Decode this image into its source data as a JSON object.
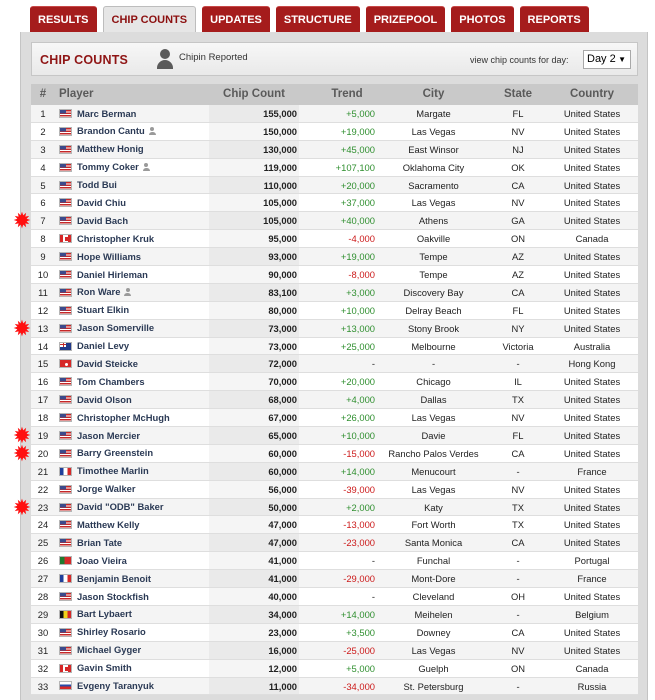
{
  "tabs": [
    "RESULTS",
    "CHIP COUNTS",
    "UPDATES",
    "STRUCTURE",
    "PRIZEPOOL",
    "PHOTOS",
    "REPORTS"
  ],
  "active_tab": "CHIP COUNTS",
  "header": {
    "title": "CHIP COUNTS",
    "chipin_label": "Chipin Reported",
    "day_label": "view chip counts for day:",
    "day_value": "Day 2",
    "dropdown_arrow": "▼"
  },
  "columns": [
    "#",
    "Player",
    "Chip Count",
    "Trend",
    "City",
    "State",
    "Country"
  ],
  "rows": [
    {
      "rank": "1",
      "player": "Marc Berman",
      "flag": "us",
      "chipin": false,
      "chips": "155,000",
      "trend": "+5,000",
      "city": "Margate",
      "state": "FL",
      "country": "United States"
    },
    {
      "rank": "2",
      "player": "Brandon Cantu",
      "flag": "us",
      "chipin": true,
      "chips": "150,000",
      "trend": "+19,000",
      "city": "Las Vegas",
      "state": "NV",
      "country": "United States"
    },
    {
      "rank": "3",
      "player": "Matthew Honig",
      "flag": "us",
      "chipin": false,
      "chips": "130,000",
      "trend": "+45,000",
      "city": "East Winsor",
      "state": "NJ",
      "country": "United States"
    },
    {
      "rank": "4",
      "player": "Tommy Coker",
      "flag": "us",
      "chipin": true,
      "chips": "119,000",
      "trend": "+107,100",
      "city": "Oklahoma City",
      "state": "OK",
      "country": "United States"
    },
    {
      "rank": "5",
      "player": "Todd Bui",
      "flag": "us",
      "chipin": false,
      "chips": "110,000",
      "trend": "+20,000",
      "city": "Sacramento",
      "state": "CA",
      "country": "United States"
    },
    {
      "rank": "6",
      "player": "David Chiu",
      "flag": "us",
      "chipin": false,
      "chips": "105,000",
      "trend": "+37,000",
      "city": "Las Vegas",
      "state": "NV",
      "country": "United States"
    },
    {
      "rank": "7",
      "player": "David Bach",
      "flag": "us",
      "chipin": false,
      "chips": "105,000",
      "trend": "+40,000",
      "city": "Athens",
      "state": "GA",
      "country": "United States"
    },
    {
      "rank": "8",
      "player": "Christopher Kruk",
      "flag": "ca",
      "chipin": false,
      "chips": "95,000",
      "trend": "-4,000",
      "city": "Oakville",
      "state": "ON",
      "country": "Canada"
    },
    {
      "rank": "9",
      "player": "Hope Williams",
      "flag": "us",
      "chipin": false,
      "chips": "93,000",
      "trend": "+19,000",
      "city": "Tempe",
      "state": "AZ",
      "country": "United States"
    },
    {
      "rank": "10",
      "player": "Daniel Hirleman",
      "flag": "us",
      "chipin": false,
      "chips": "90,000",
      "trend": "-8,000",
      "city": "Tempe",
      "state": "AZ",
      "country": "United States"
    },
    {
      "rank": "11",
      "player": "Ron Ware",
      "flag": "us",
      "chipin": true,
      "chips": "83,100",
      "trend": "+3,000",
      "city": "Discovery Bay",
      "state": "CA",
      "country": "United States"
    },
    {
      "rank": "12",
      "player": "Stuart Elkin",
      "flag": "us",
      "chipin": false,
      "chips": "80,000",
      "trend": "+10,000",
      "city": "Delray Beach",
      "state": "FL",
      "country": "United States"
    },
    {
      "rank": "13",
      "player": "Jason Somerville",
      "flag": "us",
      "chipin": false,
      "chips": "73,000",
      "trend": "+13,000",
      "city": "Stony Brook",
      "state": "NY",
      "country": "United States"
    },
    {
      "rank": "14",
      "player": "Daniel Levy",
      "flag": "au",
      "chipin": false,
      "chips": "73,000",
      "trend": "+25,000",
      "city": "Melbourne",
      "state": "Victoria",
      "country": "Australia"
    },
    {
      "rank": "15",
      "player": "David Steicke",
      "flag": "hk",
      "chipin": false,
      "chips": "72,000",
      "trend": "-",
      "city": "-",
      "state": "-",
      "country": "Hong Kong"
    },
    {
      "rank": "16",
      "player": "Tom Chambers",
      "flag": "us",
      "chipin": false,
      "chips": "70,000",
      "trend": "+20,000",
      "city": "Chicago",
      "state": "IL",
      "country": "United States"
    },
    {
      "rank": "17",
      "player": "David Olson",
      "flag": "us",
      "chipin": false,
      "chips": "68,000",
      "trend": "+4,000",
      "city": "Dallas",
      "state": "TX",
      "country": "United States"
    },
    {
      "rank": "18",
      "player": "Christopher McHugh",
      "flag": "us",
      "chipin": false,
      "chips": "67,000",
      "trend": "+26,000",
      "city": "Las Vegas",
      "state": "NV",
      "country": "United States"
    },
    {
      "rank": "19",
      "player": "Jason Mercier",
      "flag": "us",
      "chipin": false,
      "chips": "65,000",
      "trend": "+10,000",
      "city": "Davie",
      "state": "FL",
      "country": "United States"
    },
    {
      "rank": "20",
      "player": "Barry Greenstein",
      "flag": "us",
      "chipin": false,
      "chips": "60,000",
      "trend": "-15,000",
      "city": "Rancho Palos Verdes",
      "state": "CA",
      "country": "United States"
    },
    {
      "rank": "21",
      "player": "Timothee Marlin",
      "flag": "fr",
      "chipin": false,
      "chips": "60,000",
      "trend": "+14,000",
      "city": "Menucourt",
      "state": "-",
      "country": "France"
    },
    {
      "rank": "22",
      "player": "Jorge Walker",
      "flag": "us",
      "chipin": false,
      "chips": "56,000",
      "trend": "-39,000",
      "city": "Las Vegas",
      "state": "NV",
      "country": "United States"
    },
    {
      "rank": "23",
      "player": "David \"ODB\" Baker",
      "flag": "us",
      "chipin": false,
      "chips": "50,000",
      "trend": "+2,000",
      "city": "Katy",
      "state": "TX",
      "country": "United States"
    },
    {
      "rank": "24",
      "player": "Matthew Kelly",
      "flag": "us",
      "chipin": false,
      "chips": "47,000",
      "trend": "-13,000",
      "city": "Fort Worth",
      "state": "TX",
      "country": "United States"
    },
    {
      "rank": "25",
      "player": "Brian Tate",
      "flag": "us",
      "chipin": false,
      "chips": "47,000",
      "trend": "-23,000",
      "city": "Santa Monica",
      "state": "CA",
      "country": "United States"
    },
    {
      "rank": "26",
      "player": "Joao Vieira",
      "flag": "pt",
      "chipin": false,
      "chips": "41,000",
      "trend": "-",
      "city": "Funchal",
      "state": "-",
      "country": "Portugal"
    },
    {
      "rank": "27",
      "player": "Benjamin Benoit",
      "flag": "fr",
      "chipin": false,
      "chips": "41,000",
      "trend": "-29,000",
      "city": "Mont-Dore",
      "state": "-",
      "country": "France"
    },
    {
      "rank": "28",
      "player": "Jason Stockfish",
      "flag": "us",
      "chipin": false,
      "chips": "40,000",
      "trend": "-",
      "city": "Cleveland",
      "state": "OH",
      "country": "United States"
    },
    {
      "rank": "29",
      "player": "Bart Lybaert",
      "flag": "be",
      "chipin": false,
      "chips": "34,000",
      "trend": "+14,000",
      "city": "Meihelen",
      "state": "-",
      "country": "Belgium"
    },
    {
      "rank": "30",
      "player": "Shirley Rosario",
      "flag": "us",
      "chipin": false,
      "chips": "23,000",
      "trend": "+3,500",
      "city": "Downey",
      "state": "CA",
      "country": "United States"
    },
    {
      "rank": "31",
      "player": "Michael Gyger",
      "flag": "us",
      "chipin": false,
      "chips": "16,000",
      "trend": "-25,000",
      "city": "Las Vegas",
      "state": "NV",
      "country": "United States"
    },
    {
      "rank": "32",
      "player": "Gavin Smith",
      "flag": "ca",
      "chipin": false,
      "chips": "12,000",
      "trend": "+5,000",
      "city": "Guelph",
      "state": "ON",
      "country": "Canada"
    },
    {
      "rank": "33",
      "player": "Evgeny Taranyuk",
      "flag": "ru",
      "chipin": false,
      "chips": "11,000",
      "trend": "-34,000",
      "city": "St. Petersburg",
      "state": "-",
      "country": "Russia"
    }
  ],
  "starred_ranks": [
    "7",
    "13",
    "19",
    "20",
    "23"
  ],
  "colors": {
    "tab_bg": "#a51c1c",
    "title": "#8f1515",
    "trend_positive": "#2f8f2f",
    "trend_negative": "#cc1a1a",
    "star": "#ff1010"
  }
}
